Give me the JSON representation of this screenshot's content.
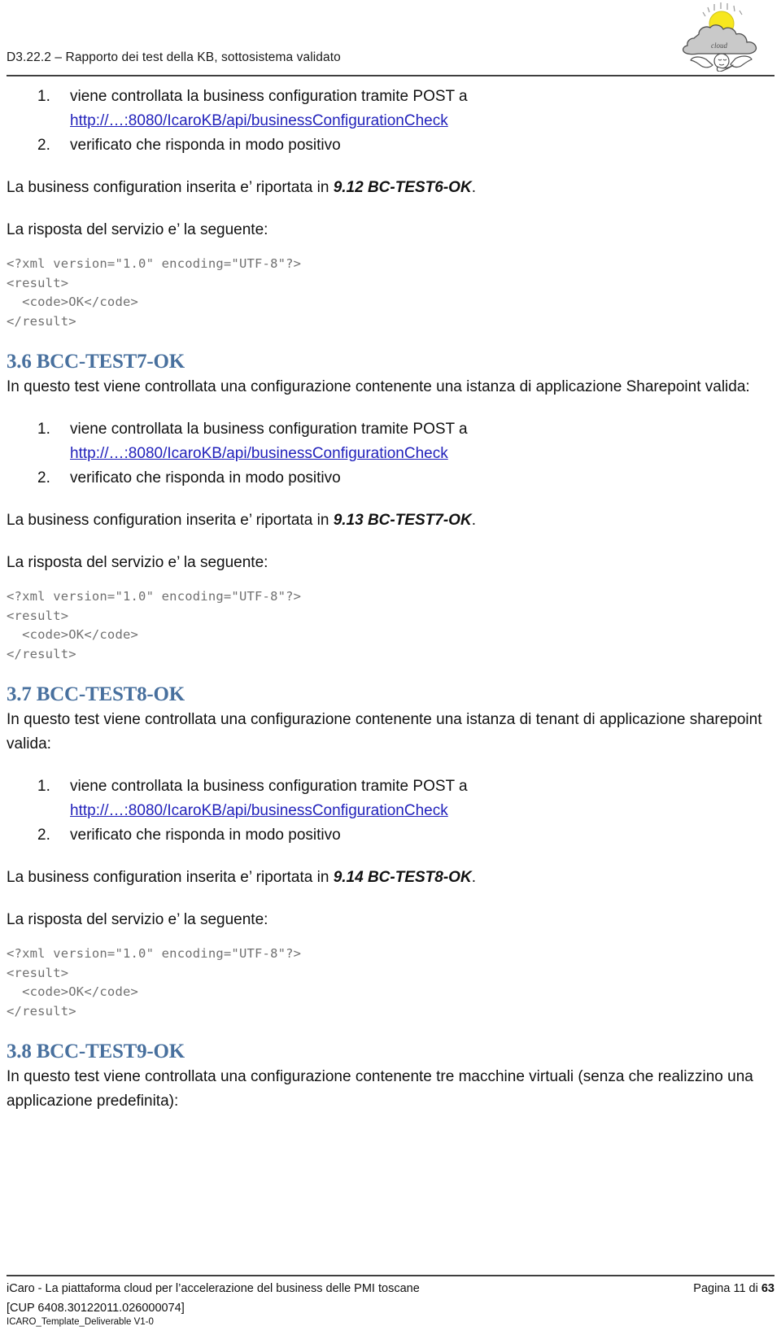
{
  "header": {
    "title": "D3.22.2 – Rapporto dei test della KB, sottosistema validato",
    "logo_icon": "cloud-sun-cherub-logo",
    "logo_word": "cloud"
  },
  "content": {
    "block_top": {
      "steps": [
        {
          "marker": "1.",
          "text": "viene controllata la business configuration tramite POST a",
          "url": "http://…:8080/IcaroKB/api/businessConfigurationCheck"
        },
        {
          "marker": "2.",
          "text": "verificato che risponda in modo positivo",
          "url": ""
        }
      ],
      "inserted_line_prefix": "La business configuration inserita e’ riportata in ",
      "inserted_line_ref": "9.12 BC-TEST6-OK",
      "inserted_line_suffix": ".",
      "response_line": "La risposta del servizio e’ la seguente:",
      "code": "<?xml version=\"1.0\" encoding=\"UTF-8\"?>\n<result>\n  <code>OK</code>\n</result>"
    },
    "sections": [
      {
        "heading": "3.6 BCC-TEST7-OK",
        "intro": "In questo test viene controllata una configurazione contenente una istanza di applicazione Sharepoint valida:",
        "steps": [
          {
            "marker": "1.",
            "text": "viene controllata la business configuration tramite POST a",
            "url": "http://…:8080/IcaroKB/api/businessConfigurationCheck"
          },
          {
            "marker": "2.",
            "text": "verificato che risponda in modo positivo",
            "url": ""
          }
        ],
        "inserted_line_prefix": "La business configuration inserita e’ riportata in ",
        "inserted_line_ref": "9.13 BC-TEST7-OK",
        "inserted_line_suffix": ".",
        "response_line": "La risposta del servizio e’ la seguente:",
        "code": "<?xml version=\"1.0\" encoding=\"UTF-8\"?>\n<result>\n  <code>OK</code>\n</result>"
      },
      {
        "heading": "3.7 BCC-TEST8-OK",
        "intro": "In questo test viene controllata una configurazione contenente una istanza di tenant di applicazione sharepoint valida:",
        "steps": [
          {
            "marker": "1.",
            "text": "viene controllata la business configuration tramite POST a",
            "url": "http://…:8080/IcaroKB/api/businessConfigurationCheck"
          },
          {
            "marker": "2.",
            "text": "verificato che risponda in modo positivo",
            "url": ""
          }
        ],
        "inserted_line_prefix": "La business configuration inserita e’ riportata in ",
        "inserted_line_ref": "9.14 BC-TEST8-OK",
        "inserted_line_suffix": ".",
        "response_line": "La risposta del servizio e’ la seguente:",
        "code": "<?xml version=\"1.0\" encoding=\"UTF-8\"?>\n<result>\n  <code>OK</code>\n</result>"
      },
      {
        "heading": "3.8 BCC-TEST9-OK",
        "intro": "In questo test viene controllata una configurazione contenente tre macchine virtuali (senza che realizzino una applicazione predefinita):",
        "steps": [],
        "inserted_line_prefix": "",
        "inserted_line_ref": "",
        "inserted_line_suffix": "",
        "response_line": "",
        "code": ""
      }
    ]
  },
  "footer": {
    "left": "iCaro - La piattaforma cloud per l’accelerazione del business delle PMI toscane",
    "page_prefix": "Pagina 11 di ",
    "page_total": "63",
    "cup": "[CUP 6408.30122011.026000074]",
    "template": "ICARO_Template_Deliverable V1-0"
  },
  "colors": {
    "heading_blue": "#48709e",
    "link_blue": "#2222bb",
    "code_gray": "#707070",
    "rule_gray": "#3f3f3f"
  }
}
